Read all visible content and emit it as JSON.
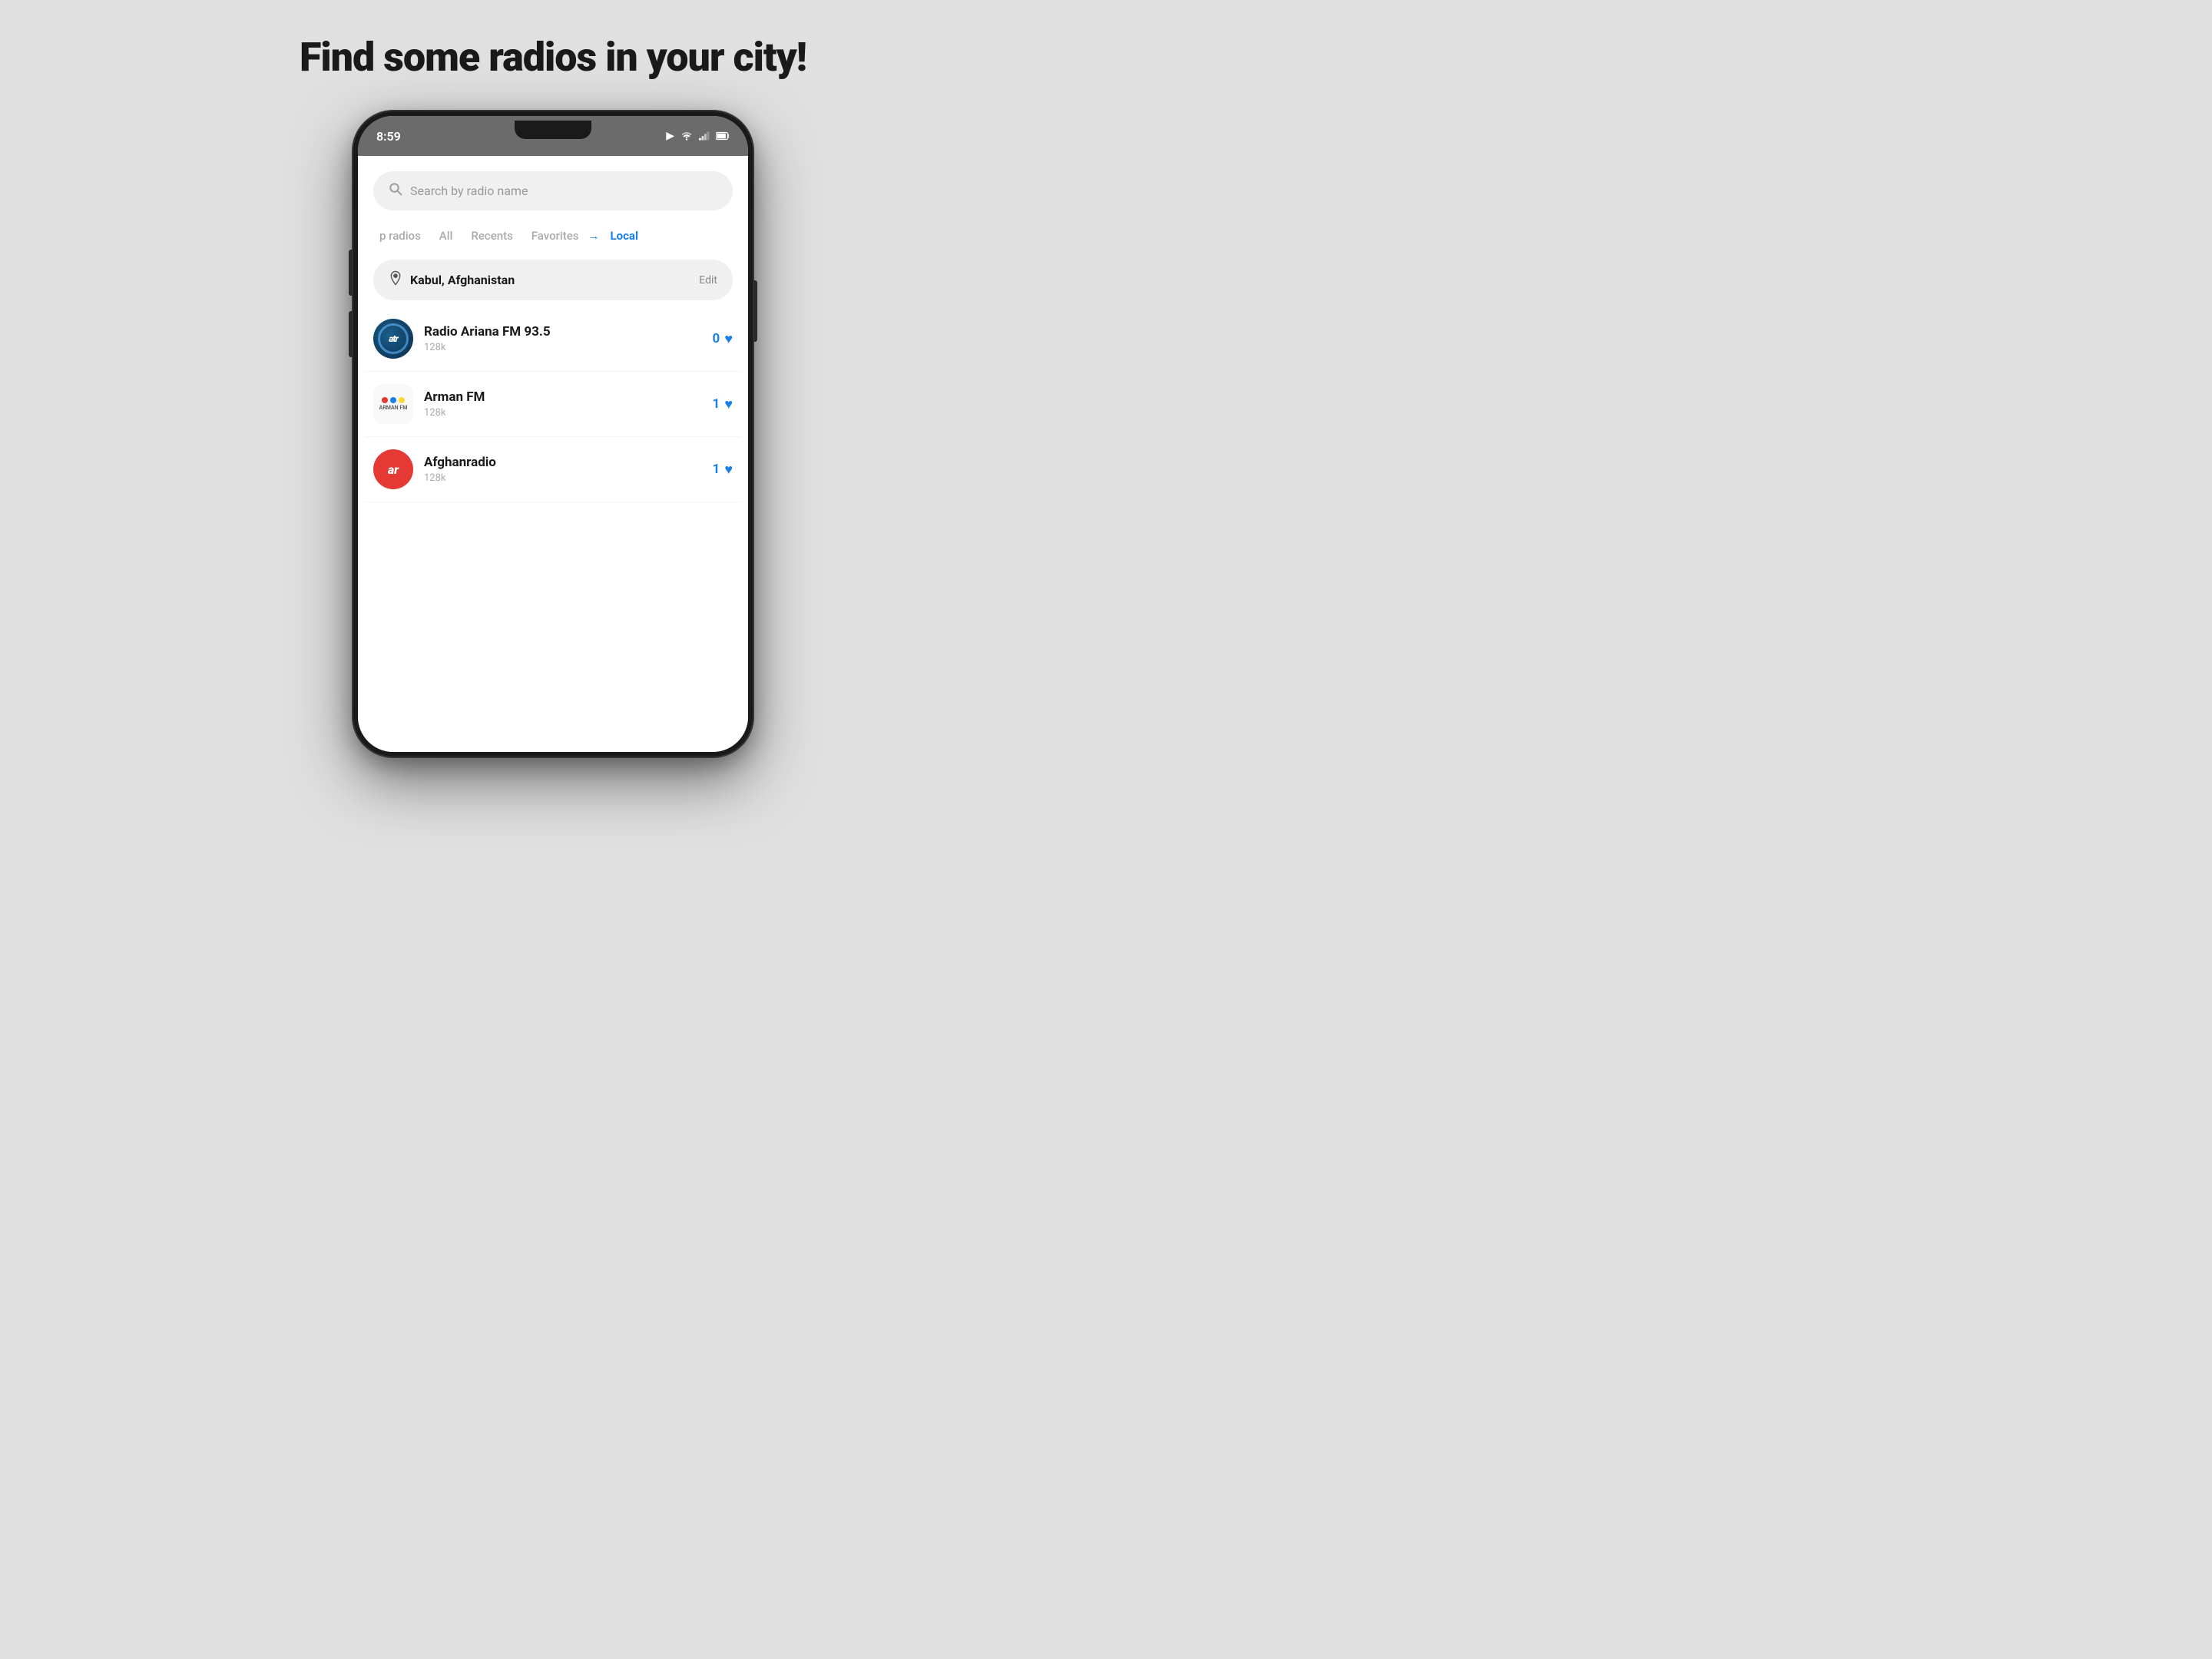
{
  "page": {
    "title": "Find some radios in your city!",
    "background_color": "#e0e0e0"
  },
  "status_bar": {
    "time": "8:59",
    "wifi": "wifi",
    "signal": "signal",
    "battery": "battery"
  },
  "search": {
    "placeholder": "Search by radio name"
  },
  "tabs": [
    {
      "id": "top",
      "label": "p radios",
      "active": false
    },
    {
      "id": "all",
      "label": "All",
      "active": false
    },
    {
      "id": "recents",
      "label": "Recents",
      "active": false
    },
    {
      "id": "favorites",
      "label": "Favorites",
      "active": false
    },
    {
      "id": "local",
      "label": "Local",
      "active": true
    }
  ],
  "location": {
    "name": "Kabul, Afghanistan",
    "edit_label": "Edit"
  },
  "radios": [
    {
      "id": 1,
      "name": "Radio Ariana FM 93.5",
      "bitrate": "128k",
      "likes": "0",
      "logo_type": "atr"
    },
    {
      "id": 2,
      "name": "Arman FM",
      "bitrate": "128k",
      "likes": "1",
      "logo_type": "arman"
    },
    {
      "id": 3,
      "name": "Afghanradio",
      "bitrate": "128k",
      "likes": "1",
      "logo_type": "afghan"
    }
  ]
}
